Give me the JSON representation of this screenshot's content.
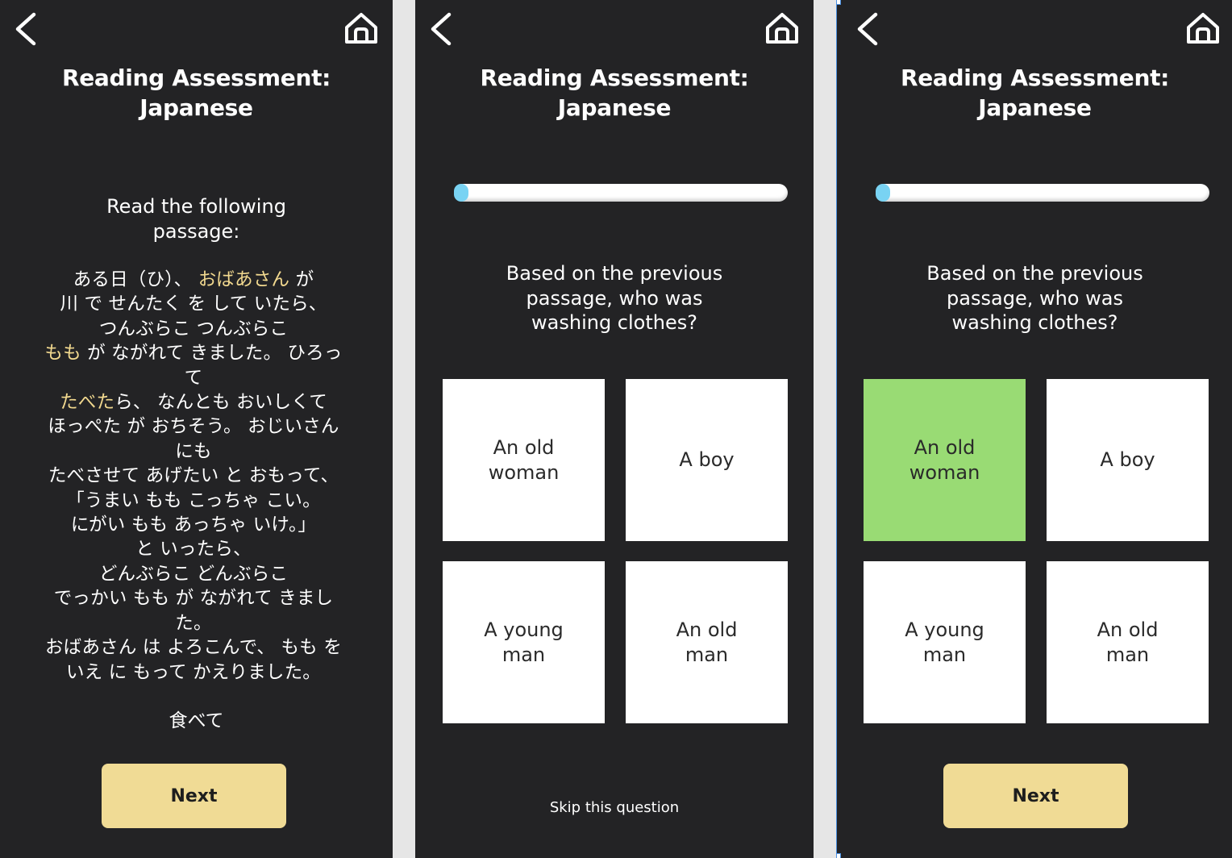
{
  "common": {
    "title": "Reading Assessment:\nJapanese",
    "back_icon": "chevron-left-icon",
    "home_icon": "home-icon"
  },
  "colors": {
    "background": "#232325",
    "highlight": "#f2d98f",
    "next_button": "#f0db95",
    "selected_option": "#99db74",
    "progress": "#79d3f3"
  },
  "screen1": {
    "instruction": "Read the following\npassage:",
    "passage_lines": [
      [
        {
          "t": "ある日（ひ）、 "
        },
        {
          "t": "おばあさん",
          "hl": true
        },
        {
          "t": " が"
        }
      ],
      [
        {
          "t": "川 で せんたく を して いたら、"
        }
      ],
      [
        {
          "t": "つんぶらこ つんぶらこ"
        }
      ],
      [
        {
          "t": "もも",
          "hl": true
        },
        {
          "t": " が ながれて きました。 ひろっ"
        }
      ],
      [
        {
          "t": "て"
        }
      ],
      [
        {
          "t": "たべた",
          "hl": true
        },
        {
          "t": "ら、 なんとも おいしくて"
        }
      ],
      [
        {
          "t": "ほっぺた が おちそう。 おじいさん"
        }
      ],
      [
        {
          "t": "にも"
        }
      ],
      [
        {
          "t": "たべさせて あげたい と おもって、"
        }
      ],
      [
        {
          "t": "「うまい もも こっちゃ こい。"
        }
      ],
      [
        {
          "t": "にがい もも あっちゃ いけ。」"
        }
      ],
      [
        {
          "t": "と いったら、"
        }
      ],
      [
        {
          "t": "どんぶらこ どんぶらこ"
        }
      ],
      [
        {
          "t": "でっかい もも が ながれて きまし"
        }
      ],
      [
        {
          "t": "た。"
        }
      ],
      [
        {
          "t": "おばあさん は よろこんで、 もも を"
        }
      ],
      [
        {
          "t": "いえ に もって かえりました。"
        }
      ]
    ],
    "vocab_word": "食べて",
    "next_label": "Next"
  },
  "screen2": {
    "progress_fraction": 0.03,
    "question": "Based on the previous\npassage, who was\nwashing clothes?",
    "options": [
      "An old\nwoman",
      "A boy",
      "A young\nman",
      "An old\nman"
    ],
    "selected_index": null,
    "skip_label": "Skip this question"
  },
  "screen3": {
    "progress_fraction": 0.03,
    "question": "Based on the previous\npassage, who was\nwashing clothes?",
    "options": [
      "An old\nwoman",
      "A boy",
      "A young\nman",
      "An old\nman"
    ],
    "selected_index": 0,
    "next_label": "Next"
  }
}
